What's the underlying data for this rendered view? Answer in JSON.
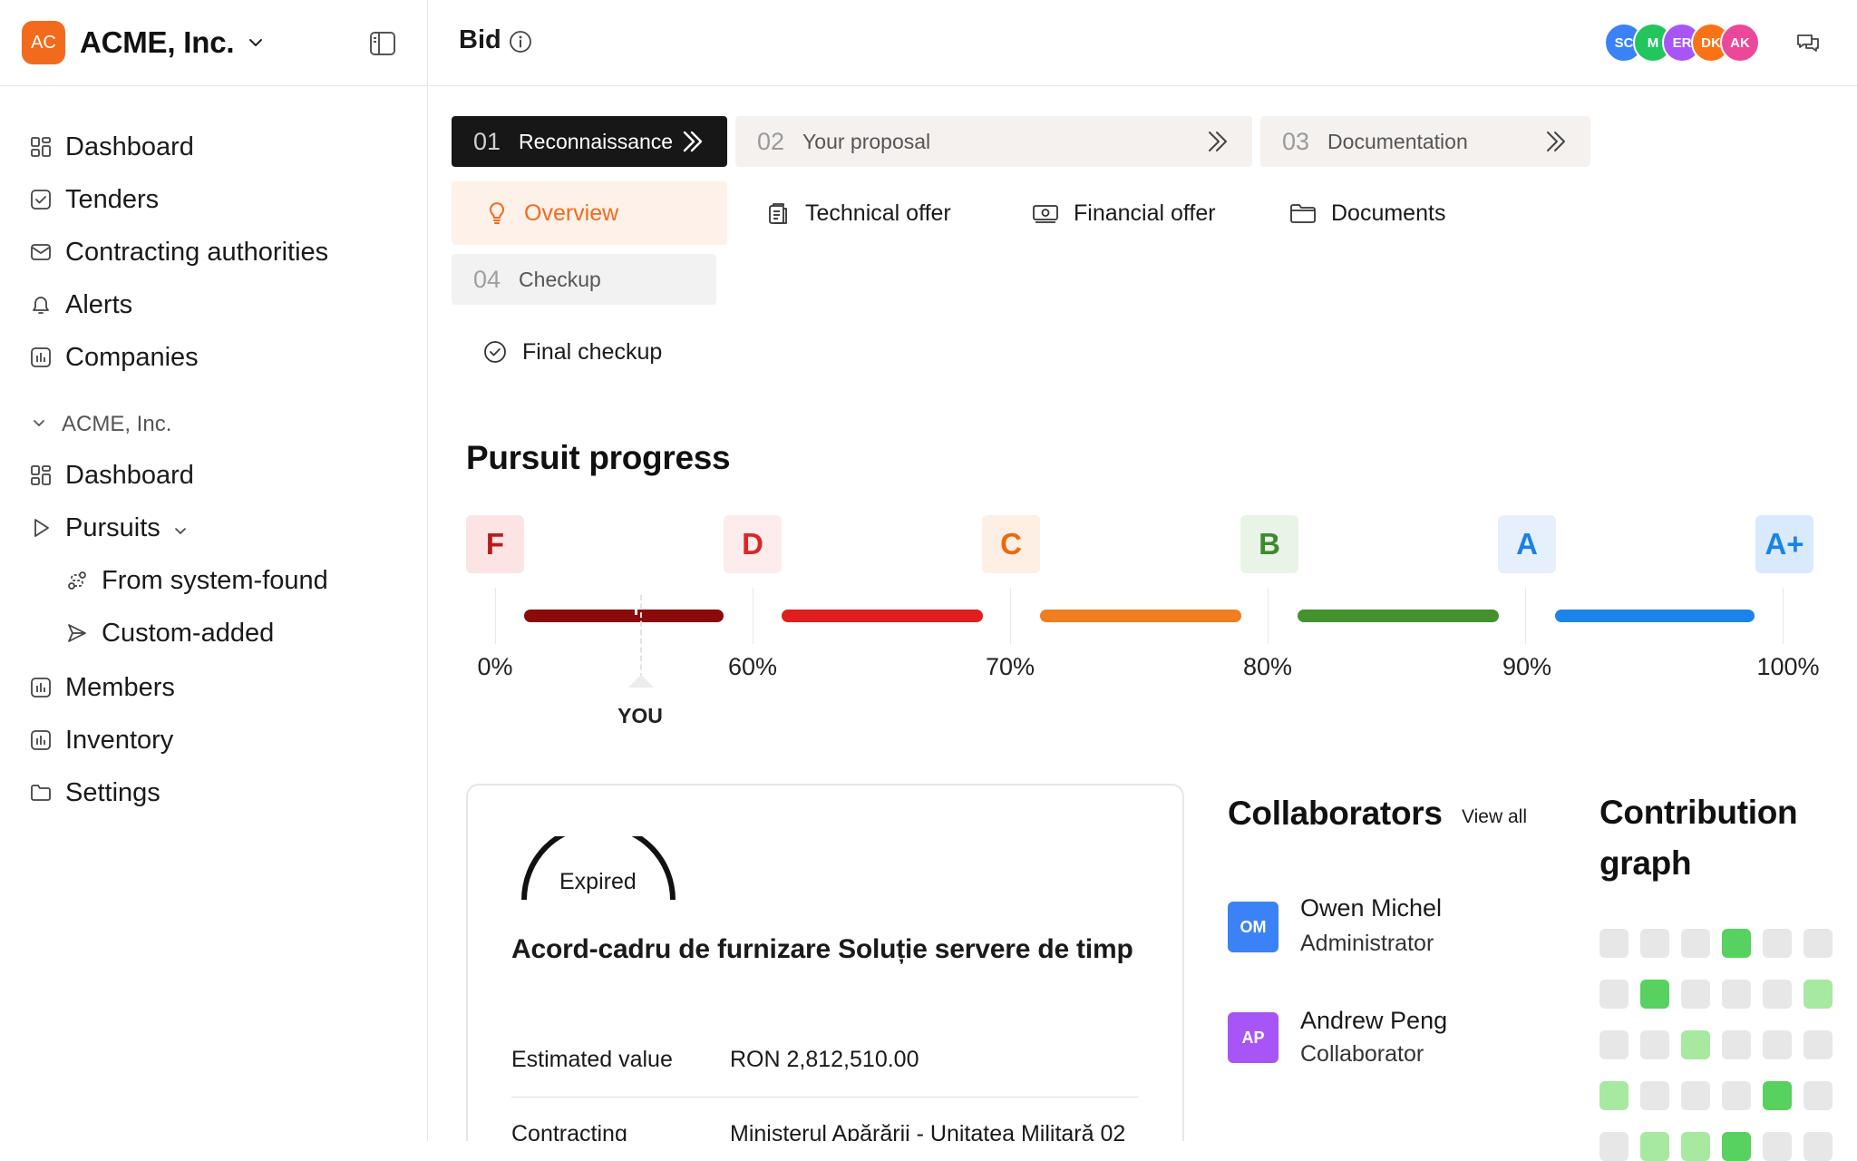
{
  "app": {
    "org_initials": "AC",
    "org_name": "ACME, Inc."
  },
  "sidebar": {
    "nav": [
      {
        "label": "Dashboard",
        "icon": "grid-icon"
      },
      {
        "label": "Tenders",
        "icon": "checkbox-icon"
      },
      {
        "label": "Contracting authorities",
        "icon": "mail-icon"
      },
      {
        "label": "Alerts",
        "icon": "bell-icon"
      },
      {
        "label": "Companies",
        "icon": "bar-chart-icon"
      }
    ],
    "section_label": "ACME, Inc.",
    "org_nav": [
      {
        "label": "Dashboard",
        "icon": "grid-icon"
      },
      {
        "label": "Pursuits",
        "icon": "play-icon"
      },
      {
        "label": "From system-found",
        "icon": "route-icon"
      },
      {
        "label": "Custom-added",
        "icon": "send-icon"
      },
      {
        "label": "Members",
        "icon": "bar-chart-icon"
      },
      {
        "label": "Inventory",
        "icon": "bar-chart-icon"
      },
      {
        "label": "Settings",
        "icon": "folder-icon"
      }
    ]
  },
  "header": {
    "title": "Bid",
    "avatars": [
      {
        "initials": "SC",
        "color": "#3b82f6"
      },
      {
        "initials": "M",
        "color": "#22c55e"
      },
      {
        "initials": "ER",
        "color": "#a855f7"
      },
      {
        "initials": "DK",
        "color": "#f97316"
      },
      {
        "initials": "AK",
        "color": "#ec4899"
      }
    ]
  },
  "steps": [
    {
      "num": "01",
      "label": "Reconnaissance"
    },
    {
      "num": "02",
      "label": "Your proposal"
    },
    {
      "num": "03",
      "label": "Documentation"
    },
    {
      "num": "04",
      "label": "Checkup"
    }
  ],
  "subtabs": {
    "overview": "Overview",
    "technical": "Technical offer",
    "financial": "Financial offer",
    "documents": "Documents",
    "final_checkup": "Final checkup"
  },
  "progress": {
    "title": "Pursuit progress",
    "grades": [
      {
        "label": "F",
        "bg": "#fde4e4",
        "fg": "#b91c1c"
      },
      {
        "label": "D",
        "bg": "#fdecec",
        "fg": "#dc2626"
      },
      {
        "label": "C",
        "bg": "#fdefe3",
        "fg": "#ea6a0c"
      },
      {
        "label": "B",
        "bg": "#e8f5e6",
        "fg": "#3f8a2f"
      },
      {
        "label": "A",
        "bg": "#e6f0fd",
        "fg": "#1a82e8"
      },
      {
        "label": "A+",
        "bg": "#d9eafd",
        "fg": "#1a82e8"
      }
    ],
    "bar_colors": [
      "#8b0a0a",
      "#e11d1d",
      "#f07d1e",
      "#43922f",
      "#1b84ec"
    ],
    "percent_labels": [
      "0%",
      "60%",
      "70%",
      "80%",
      "90%",
      "100%"
    ],
    "you_label": "YOU"
  },
  "tender": {
    "status": "Expired",
    "title": "Acord-cadru de furnizare Soluție servere de timp",
    "estimated_value_label": "Estimated value",
    "estimated_value": "RON 2,812,510.00",
    "contracting_label": "Contracting",
    "contracting_value": "Ministerul Apărării - Unitatea Militară 02"
  },
  "collaborators": {
    "title": "Collaborators",
    "view_all": "View all",
    "people": [
      {
        "initials": "OM",
        "name": "Owen Michel",
        "role": "Administrator",
        "color": "#3b82f6"
      },
      {
        "initials": "AP",
        "name": "Andrew Peng",
        "role": "Collaborator",
        "color": "#a855f7"
      }
    ]
  },
  "contribution": {
    "title": "Contribution graph",
    "colors": {
      "0": "#e7e7e7",
      "1": "#a7e9a0",
      "2": "#57d15f"
    },
    "levels": [
      [
        0,
        0,
        0,
        2,
        0,
        0
      ],
      [
        0,
        2,
        0,
        0,
        0,
        1
      ],
      [
        0,
        0,
        1,
        0,
        0,
        0
      ],
      [
        1,
        0,
        0,
        0,
        2,
        0
      ],
      [
        0,
        1,
        1,
        2,
        0,
        0
      ]
    ]
  }
}
